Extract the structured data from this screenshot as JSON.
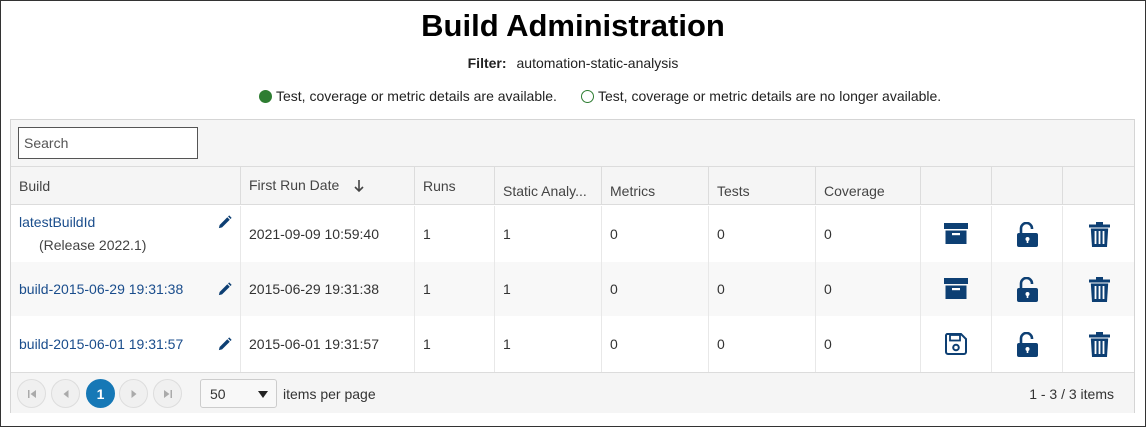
{
  "page": {
    "title": "Build Administration",
    "filter_label": "Filter:",
    "filter_value": "automation-static-analysis",
    "legend_available": "Test, coverage or metric details are available.",
    "legend_unavailable": "Test, coverage or metric details are no longer available."
  },
  "search": {
    "placeholder": "Search"
  },
  "columns": {
    "build": "Build",
    "first_run_date": "First Run Date",
    "runs": "Runs",
    "static_analysis": "Static Analy...",
    "metrics": "Metrics",
    "tests": "Tests",
    "coverage": "Coverage"
  },
  "sort_icon": "arrow-down-icon",
  "rows": [
    {
      "build": "latestBuildId",
      "release": "(Release 2022.1)",
      "first_run_date": "2021-09-09 10:59:40",
      "runs": "1",
      "static_analysis": "1",
      "metrics": "0",
      "tests": "0",
      "coverage": "0",
      "archive_icon": "archive-icon",
      "lock_icon": "unlock-icon",
      "delete_icon": "trash-icon"
    },
    {
      "build": "build-2015-06-29 19:31:38",
      "first_run_date": "2015-06-29 19:31:38",
      "runs": "1",
      "static_analysis": "1",
      "metrics": "0",
      "tests": "0",
      "coverage": "0",
      "archive_icon": "archive-icon",
      "lock_icon": "unlock-icon",
      "delete_icon": "trash-icon"
    },
    {
      "build": "build-2015-06-01 19:31:57",
      "first_run_date": "2015-06-01 19:31:57",
      "runs": "1",
      "static_analysis": "1",
      "metrics": "0",
      "tests": "0",
      "coverage": "0",
      "archive_icon": "save-icon",
      "lock_icon": "unlock-icon",
      "delete_icon": "trash-icon"
    }
  ],
  "pager": {
    "current_page": "1",
    "page_size": "50",
    "items_per_page_label": "items per page",
    "summary": "1 - 3 / 3 items"
  },
  "colors": {
    "icon": "#0d3f73",
    "available_dot": "#2e7d32",
    "active_page": "#1678b6",
    "link": "#1a4d8c"
  }
}
